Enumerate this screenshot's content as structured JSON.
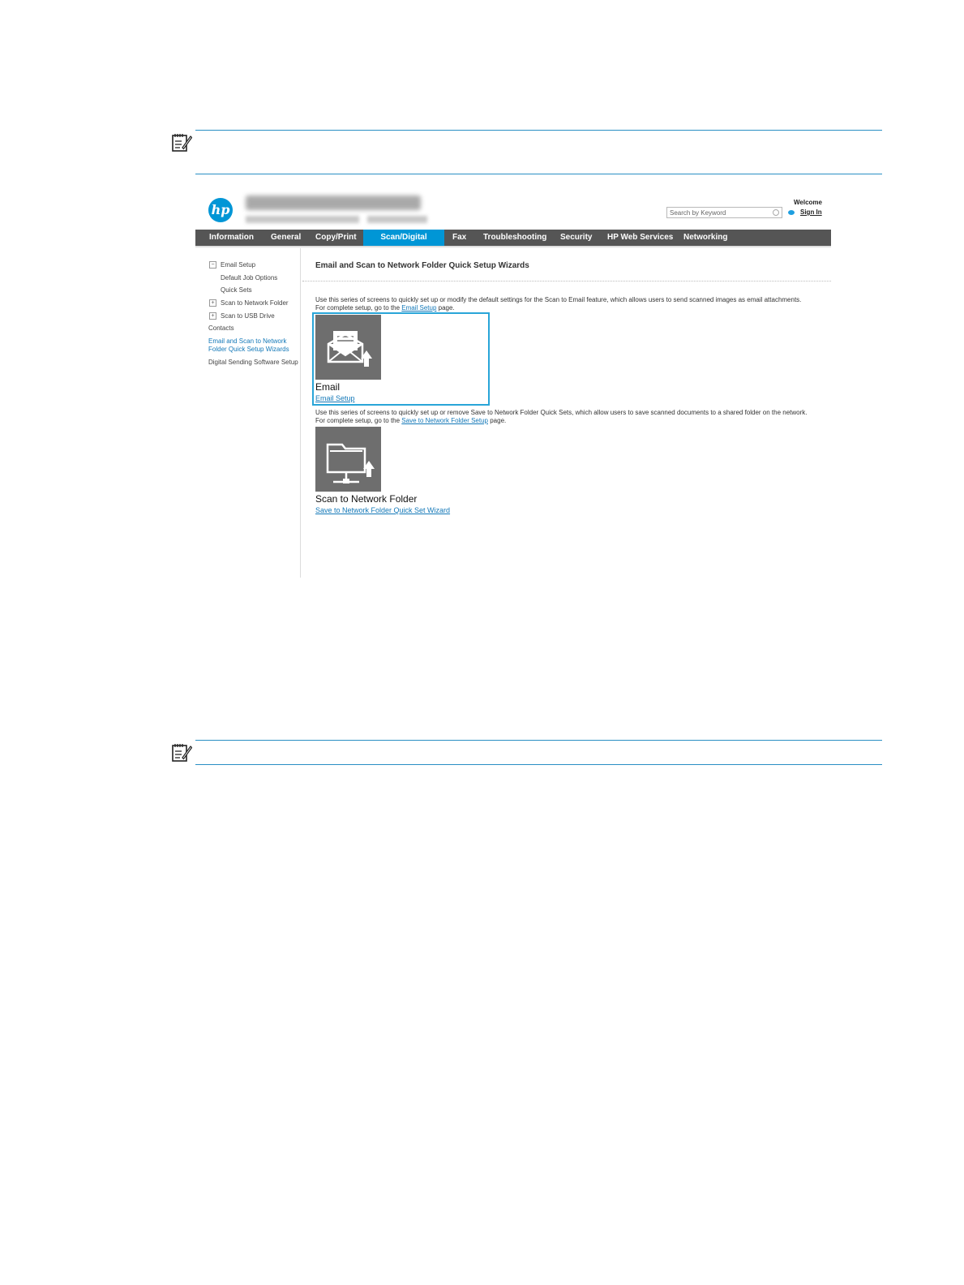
{
  "header": {
    "logo": "hp",
    "welcome": "Welcome",
    "sign_in": "Sign In",
    "search_placeholder": "Search by Keyword"
  },
  "nav": {
    "tabs": [
      {
        "label": "Information"
      },
      {
        "label": "General"
      },
      {
        "label": "Copy/Print"
      },
      {
        "label": "Scan/Digital Send",
        "active": true
      },
      {
        "label": "Fax"
      },
      {
        "label": "Troubleshooting"
      },
      {
        "label": "Security"
      },
      {
        "label": "HP Web Services"
      },
      {
        "label": "Networking"
      }
    ]
  },
  "sidebar": {
    "items": [
      {
        "label": "Email Setup",
        "toggle": "−"
      },
      {
        "label": "Default Job Options"
      },
      {
        "label": "Quick Sets"
      },
      {
        "label": "Scan to Network Folder",
        "toggle": "+"
      },
      {
        "label": "Scan to USB Drive",
        "toggle": "+"
      },
      {
        "label": "Contacts"
      },
      {
        "label": "Email and Scan to Network Folder Quick Setup Wizards",
        "selected": true
      },
      {
        "label": "Digital Sending Software Setup"
      }
    ]
  },
  "main": {
    "title": "Email and Scan to Network Folder Quick Setup Wizards",
    "email": {
      "desc_before": "Use this series of screens to quickly set up or modify the default settings for the Scan to Email feature, which allows users to send scanned images as email attachments. For complete setup, go to the ",
      "desc_link": "Email Setup",
      "desc_after": " page.",
      "tile_label": "Email",
      "link": "Email Setup",
      "icon": "email-upload-icon"
    },
    "folder": {
      "desc_before": "Use this series of screens to quickly set up or remove Save to Network Folder Quick Sets, which allow users to save scanned documents to a shared folder on the network. For complete setup, go to the ",
      "desc_link": "Save to Network Folder Setup",
      "desc_after": " page.",
      "tile_label": "Scan to Network Folder",
      "link": "Save to Network Folder Quick Set Wizard",
      "icon": "network-folder-upload-icon"
    }
  },
  "colors": {
    "accent": "#0096d6",
    "highlight": "#29a5d8",
    "nav_bg": "#555555",
    "rule": "#2a8fc4"
  }
}
